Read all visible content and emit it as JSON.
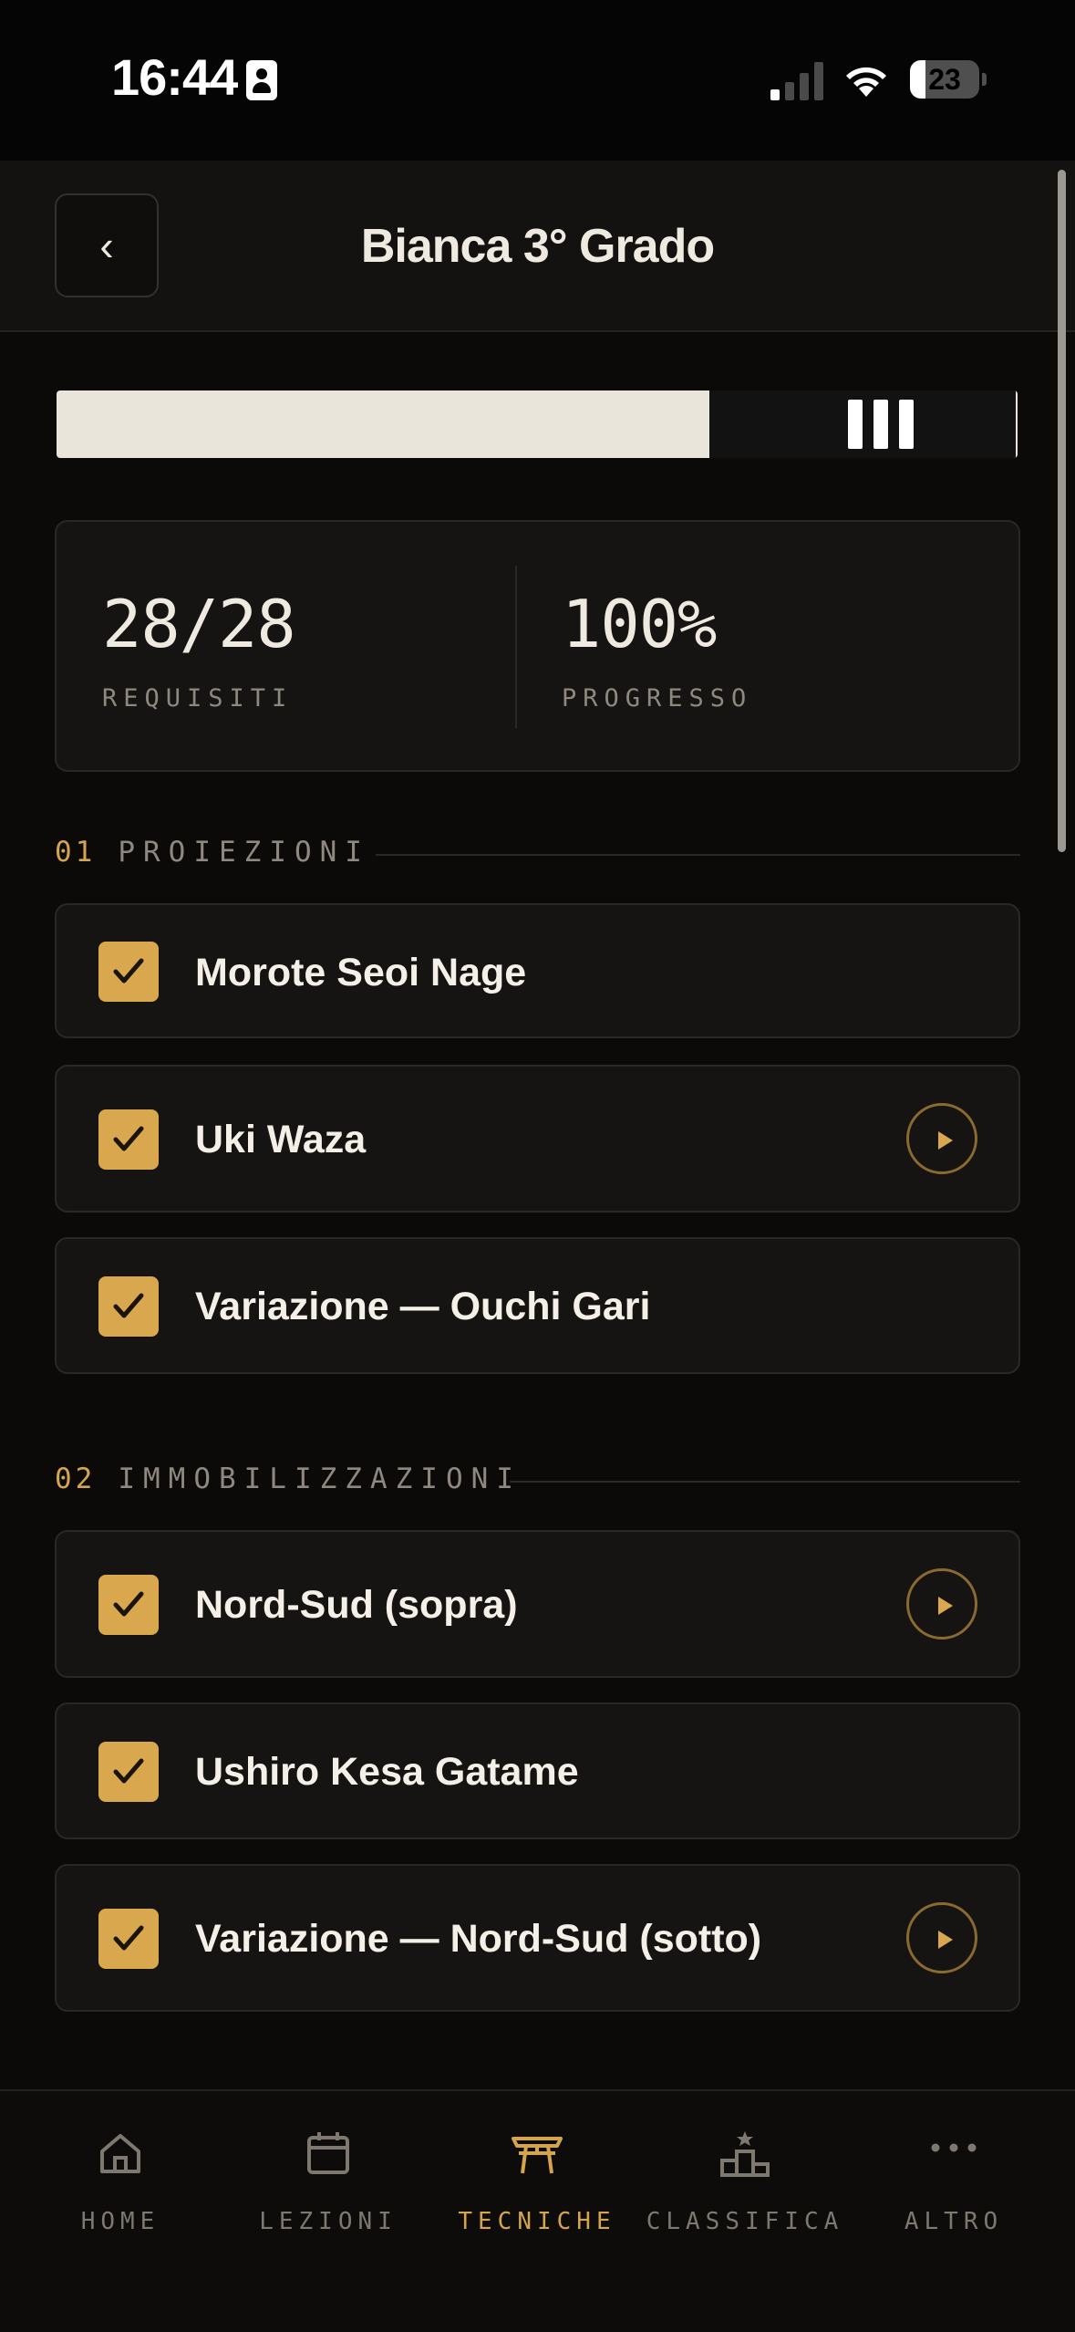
{
  "status_bar": {
    "time": "16:44",
    "battery_level": "23",
    "battery_fraction": 0.23,
    "icons": [
      "contact-card-icon",
      "cellular-signal-icon",
      "wifi-icon",
      "battery-icon"
    ]
  },
  "header": {
    "back_label": "‹",
    "title": "Bianca 3° Grado"
  },
  "belt": {
    "color": "#e9e5da",
    "tip_color": "#121212",
    "stripes": 3
  },
  "stats": {
    "requirements_value": "28/28",
    "requirements_label": "REQUISITI",
    "progress_value": "100%",
    "progress_label": "PROGRESSO"
  },
  "sections": [
    {
      "number": "01",
      "title": "PROIEZIONI",
      "items": [
        {
          "label": "Morote Seoi Nage",
          "checked": true,
          "has_video": false
        },
        {
          "label": "Uki Waza",
          "checked": true,
          "has_video": true
        },
        {
          "label": "Variazione — Ouchi Gari",
          "checked": true,
          "has_video": false
        }
      ]
    },
    {
      "number": "02",
      "title": "IMMOBILIZZAZIONI",
      "items": [
        {
          "label": "Nord-Sud (sopra)",
          "checked": true,
          "has_video": true
        },
        {
          "label": "Ushiro Kesa Gatame",
          "checked": true,
          "has_video": false
        },
        {
          "label": "Variazione — Nord-Sud (sotto)",
          "checked": true,
          "has_video": true
        }
      ]
    }
  ],
  "tab_bar": {
    "tabs": [
      {
        "label": "HOME",
        "icon": "home-icon",
        "active": false
      },
      {
        "label": "LEZIONI",
        "icon": "calendar-icon",
        "active": false
      },
      {
        "label": "TECNICHE",
        "icon": "torii-icon",
        "active": true
      },
      {
        "label": "CLASSIFICA",
        "icon": "podium-icon",
        "active": false
      },
      {
        "label": "ALTRO",
        "icon": "more-icon",
        "active": false
      }
    ]
  },
  "colors": {
    "accent": "#d9a74e",
    "background": "#0b0a09",
    "card": "#161412",
    "text": "#efeae0",
    "muted": "#8e887e"
  }
}
